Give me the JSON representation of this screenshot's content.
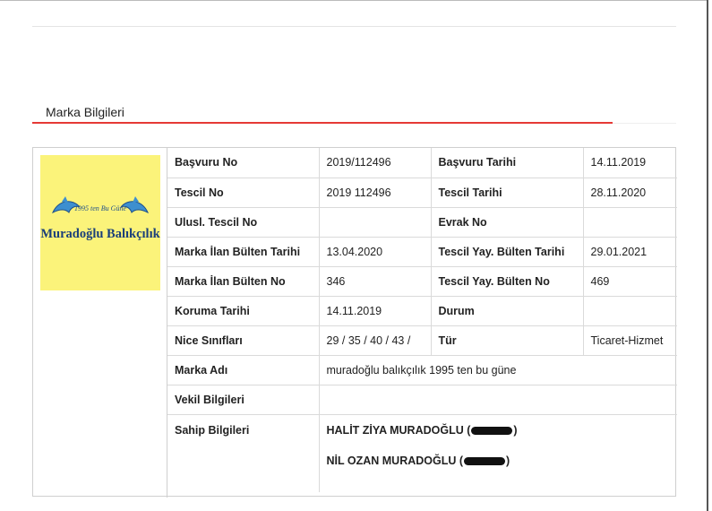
{
  "section": {
    "title": "Marka Bilgileri"
  },
  "logo": {
    "brand_text": "Muradoğlu Balıkçılık",
    "tagline": "1995 ten Bu Güne",
    "background": "#fbf37a"
  },
  "rows": [
    {
      "l1": "Başvuru No",
      "v1": "2019/112496",
      "l2": "Başvuru Tarihi",
      "v2": "14.11.2019"
    },
    {
      "l1": "Tescil No",
      "v1": "2019 112496",
      "l2": "Tescil Tarihi",
      "v2": "28.11.2020"
    },
    {
      "l1": "Ulusl. Tescil No",
      "v1": "",
      "l2": "Evrak No",
      "v2": ""
    },
    {
      "l1": "Marka İlan Bülten Tarihi",
      "v1": "13.04.2020",
      "l2": "Tescil Yay. Bülten Tarihi",
      "v2": "29.01.2021"
    },
    {
      "l1": "Marka İlan Bülten No",
      "v1": "346",
      "l2": "Tescil Yay. Bülten No",
      "v2": "469"
    },
    {
      "l1": "Koruma Tarihi",
      "v1": "14.11.2019",
      "l2": "Durum",
      "v2": ""
    },
    {
      "l1": "Nice Sınıfları",
      "v1": "29 / 35 / 40 / 43 /",
      "l2": "Tür",
      "v2": "Ticaret-Hizmet"
    }
  ],
  "marka_adi": {
    "label": "Marka Adı",
    "value": "muradoğlu balıkçılık 1995 ten bu güne"
  },
  "vekil": {
    "label": "Vekil Bilgileri",
    "value": ""
  },
  "sahip": {
    "label": "Sahip Bilgileri",
    "owners": [
      {
        "name": "HALİT ZİYA MURADOĞLU (",
        "close": ")"
      },
      {
        "name": "NİL OZAN MURADOĞLU (",
        "close": ")"
      }
    ]
  },
  "accent_color": "#e53935"
}
